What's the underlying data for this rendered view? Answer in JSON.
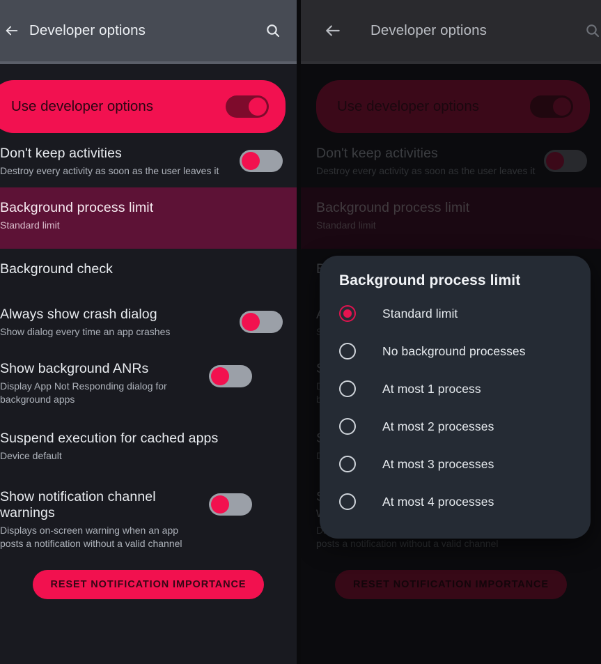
{
  "appbar": {
    "title": "Developer options",
    "back_icon": "back-arrow-icon",
    "search_icon": "search-icon"
  },
  "banner": {
    "title": "Use developer options",
    "toggle_state": "on"
  },
  "rows": [
    {
      "title": "Don't keep activities",
      "subtitle": "Destroy every activity as soon as the user leaves it",
      "toggle": "off",
      "highlighted": false
    },
    {
      "title": "Background process limit",
      "subtitle": "Standard limit",
      "toggle": null,
      "highlighted": true
    },
    {
      "title": "Background check",
      "subtitle": "",
      "toggle": null,
      "highlighted": false
    },
    {
      "title": "Always show crash dialog",
      "subtitle": "Show dialog every time an app crashes",
      "toggle": "off",
      "highlighted": false
    },
    {
      "title": "Show background ANRs",
      "subtitle": "Display App Not Responding dialog for background apps",
      "toggle": "off",
      "highlighted": false
    },
    {
      "title": "Suspend execution for cached apps",
      "subtitle": "Device default",
      "toggle": null,
      "highlighted": false
    },
    {
      "title": "Show notification channel warnings",
      "subtitle": "Displays on-screen warning when an app posts a notification without a valid channel",
      "toggle": "off",
      "highlighted": false
    }
  ],
  "reset_button": {
    "label": "RESET NOTIFICATION IMPORTANCE"
  },
  "dialog": {
    "title": "Background process limit",
    "selected_index": 0,
    "options": [
      {
        "label": "Standard limit"
      },
      {
        "label": "No background processes"
      },
      {
        "label": "At most 1 process"
      },
      {
        "label": "At most 2 processes"
      },
      {
        "label": "At most 3 processes"
      },
      {
        "label": "At most 4 processes"
      }
    ]
  },
  "colors": {
    "accent_pink": "#f2114f",
    "appbar_left": "#474b54",
    "appbar_right": "#2a2a2e",
    "content_bg": "#191a20",
    "highlight_row": "#5d1236",
    "dialog_bg": "#252b34",
    "radio_selected": "#e61450"
  }
}
